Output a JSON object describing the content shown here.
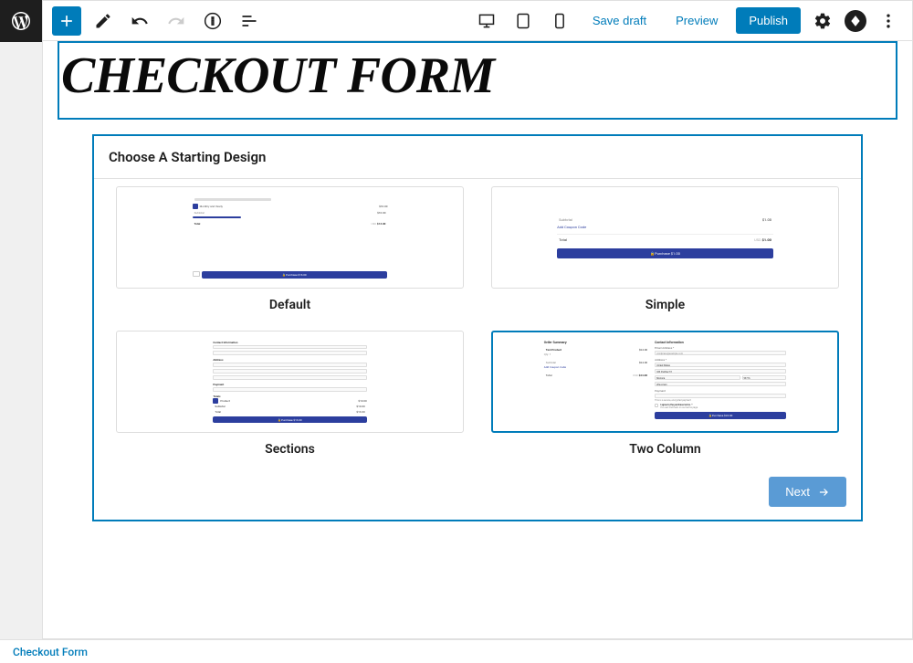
{
  "toolbar": {
    "save_draft": "Save draft",
    "preview": "Preview",
    "publish": "Publish"
  },
  "title": "CHECKOUT FORM",
  "design_picker": {
    "heading": "Choose A Starting Design",
    "options": [
      {
        "label": "Default",
        "selected": false
      },
      {
        "label": "Simple",
        "selected": false
      },
      {
        "label": "Sections",
        "selected": false
      },
      {
        "label": "Two Column",
        "selected": true
      }
    ],
    "next_label": "Next"
  },
  "footer": {
    "breadcrumb": "Checkout Form"
  },
  "preview_content": {
    "simple": {
      "subtotal_label": "Subtotal",
      "subtotal": "$1.00",
      "coupon": "Add Coupon Code",
      "total_label": "Total",
      "currency": "USD",
      "total": "$1.00",
      "button": "Purchase $1.00"
    },
    "default": {
      "subtotal_label": "Subtotal",
      "currency": "USD",
      "total": "$13.00",
      "button": "Purchase $13.00"
    },
    "sections": {
      "headers": [
        "Contact Information",
        "Address",
        "Payment",
        "Totals"
      ],
      "button": "Purchase $13.00"
    },
    "two_column": {
      "left_header": "Order Summary",
      "right_header": "Contact Information",
      "product": "Test Product",
      "qty": "Qty: 1",
      "price": "$24.00",
      "subtotal_label": "Subtotal",
      "subtotal": "$24.00",
      "coupon": "Add Coupon Code",
      "total_label": "Total",
      "currency": "USD",
      "total": "$24.00",
      "email_label": "Email Address *",
      "email_placeholder": "wordpress@example.com",
      "address_label": "Address *",
      "country": "United States",
      "street": "333 Panther Trl",
      "city": "Monona",
      "zip": "53716",
      "state": "Wisconsin",
      "payment_label": "Payment",
      "secure": "This is a secure, encrypted payment",
      "terms": "I agree to the purchase terms. *",
      "terms_sub": "You can find them on our terms page.",
      "button": "Purchase $24.00"
    }
  }
}
